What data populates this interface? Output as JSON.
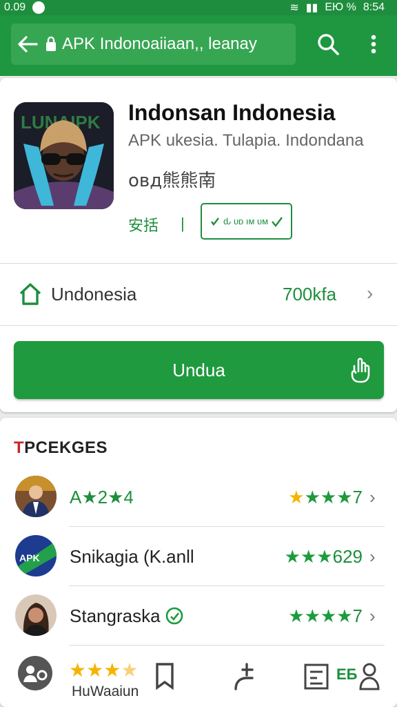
{
  "status_bar": {
    "left_text": "0.09",
    "right_text": "ЕЮ %",
    "time": "8:54"
  },
  "header": {
    "url_text": "APK Indonoaiiaan,, leanay"
  },
  "app": {
    "title": "Indonsan Indonesia",
    "subtitle": "APK ukesia. Tulapia. Indondana",
    "cjk_text": "овд熊熊南",
    "tag": "安括",
    "separator": "|",
    "rate_box_text": "ԃ ᴜᴅ ıᴍ ᴜᴍ",
    "icon_text": "LUNAIPK"
  },
  "region": {
    "label": "Undonesia",
    "value": "700kfa"
  },
  "download": {
    "label": "Undua"
  },
  "section": {
    "title_first": "T",
    "title_rest": "PCEKGES"
  },
  "list": [
    {
      "label": "A★2★4",
      "rating_text": "7"
    },
    {
      "label": "Snikagia (K.anll",
      "rating_text": "629"
    },
    {
      "label": "Stangraska",
      "rating_text": "7"
    }
  ],
  "bottom_nav": {
    "label": "HuWaaiun",
    "right_text": "EБ"
  },
  "colors": {
    "primary": "#1f9640",
    "primary_light": "#37a653",
    "accent_gold": "#f5b400"
  }
}
